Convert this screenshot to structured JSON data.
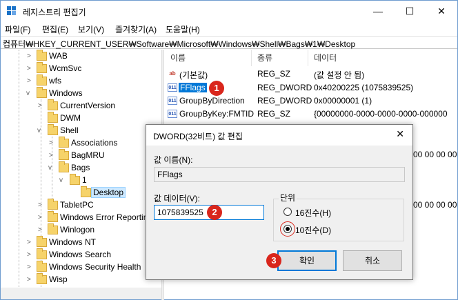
{
  "window": {
    "title": "레지스트리 편집기",
    "controls": {
      "minimize": "—",
      "maximize": "☐",
      "close": "✕"
    }
  },
  "menu": [
    "파일(F)",
    "편집(E)",
    "보기(V)",
    "즐겨찾기(A)",
    "도움말(H)"
  ],
  "address": "컴퓨터₩HKEY_CURRENT_USER₩Software₩Microsoft₩Windows₩Shell₩Bags₩1₩Desktop",
  "tree": {
    "items": [
      {
        "label": "WAB",
        "expanded": false
      },
      {
        "label": "WcmSvc",
        "expanded": false
      },
      {
        "label": "wfs",
        "expanded": false
      },
      {
        "label": "Windows",
        "expanded": true
      },
      {
        "label": "CurrentVersion",
        "expanded": false
      },
      {
        "label": "DWM",
        "expanded": false
      },
      {
        "label": "Shell",
        "expanded": true
      },
      {
        "label": "Associations",
        "expanded": false
      },
      {
        "label": "BagMRU",
        "expanded": false
      },
      {
        "label": "Bags",
        "expanded": true
      },
      {
        "label": "1",
        "expanded": true
      },
      {
        "label": "Desktop",
        "selected": true
      },
      {
        "label": "TabletPC",
        "expanded": false
      },
      {
        "label": "Windows Error Reporting",
        "expanded": false
      },
      {
        "label": "Winlogon",
        "expanded": false
      },
      {
        "label": "Windows NT",
        "expanded": false
      },
      {
        "label": "Windows Search",
        "expanded": false
      },
      {
        "label": "Windows Security Health",
        "expanded": false
      },
      {
        "label": "Wisp",
        "expanded": false
      }
    ]
  },
  "list": {
    "columns": [
      "이름",
      "종류",
      "데이터"
    ],
    "rows": [
      {
        "name": "(기본값)",
        "type": "REG_SZ",
        "data": "(값 설정 안 됨)",
        "icon": "ab"
      },
      {
        "name": "FFlags",
        "type": "REG_DWORD",
        "data": "0x40200225 (1075839525)",
        "icon": "dw",
        "selected": true
      },
      {
        "name": "GroupByDirection",
        "type": "REG_DWORD",
        "data": "0x00000001 (1)",
        "icon": "dw"
      },
      {
        "name": "GroupByKey:FMTID",
        "type": "REG_SZ",
        "data": "{00000000-0000-0000-0000-000000",
        "icon": "dw"
      }
    ],
    "partial_data": [
      "00 00 00 00",
      "00 00 00 00"
    ]
  },
  "dialog": {
    "title": "DWORD(32비트) 값 편집",
    "close": "✕",
    "value_name_label": "값 이름(N):",
    "value_name": "FFlags",
    "value_data_label": "값 데이터(V):",
    "value_data": "1075839525",
    "base_label": "단위",
    "base_hex": "16진수(H)",
    "base_dec": "10진수(D)",
    "selected_base": "decimal",
    "ok": "확인",
    "cancel": "취소"
  },
  "badges": [
    "1",
    "2",
    "3"
  ],
  "colors": {
    "accent": "#0078d7",
    "badge": "#d9261c",
    "folder": "#f6d36a"
  }
}
